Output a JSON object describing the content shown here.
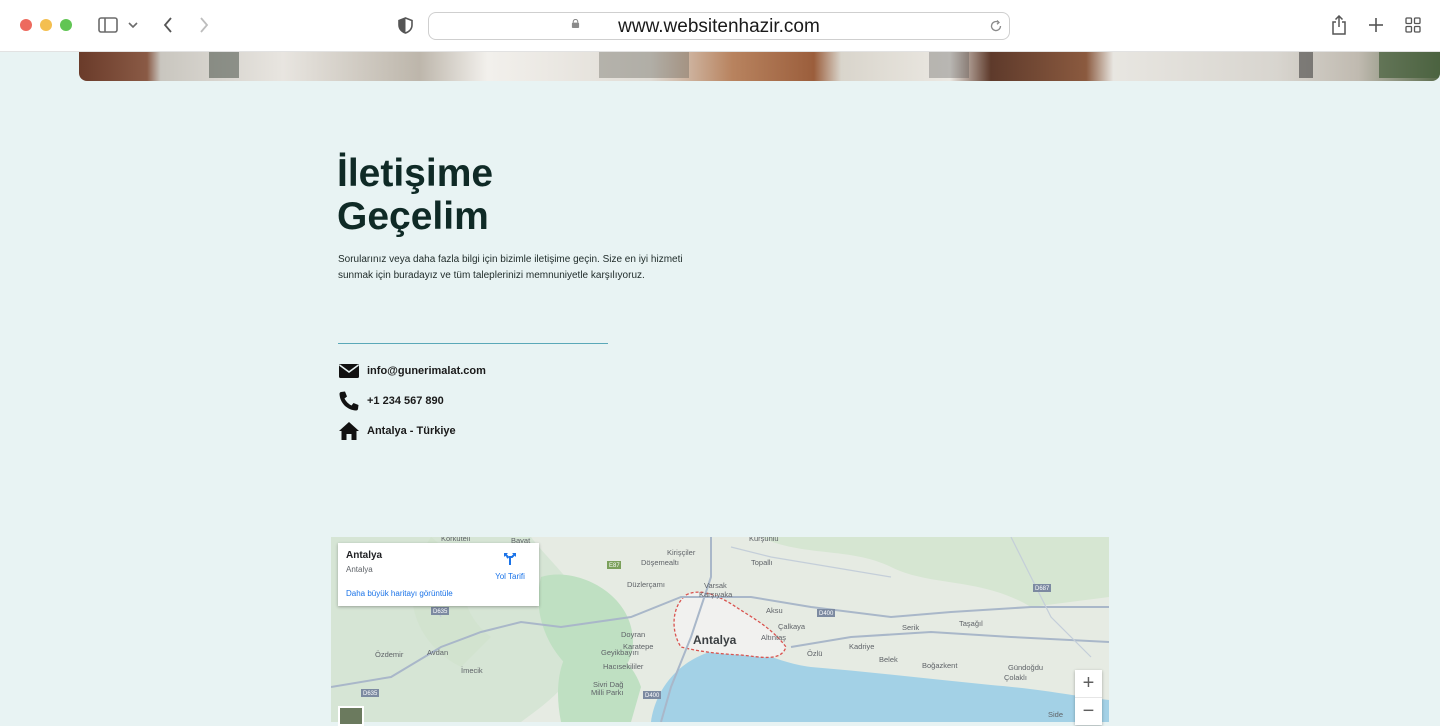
{
  "browser": {
    "url": "www.websitenhazir.com",
    "icons": [
      "sidebar-icon",
      "chevron-down-icon",
      "back-icon",
      "forward-icon",
      "shield-icon",
      "lock-icon",
      "reload-icon",
      "share-icon",
      "new-tab-icon",
      "tabs-grid-icon"
    ]
  },
  "contact": {
    "title_line1": "İletişime",
    "title_line2": "Geçelim",
    "description": "Sorularınız veya daha fazla bilgi için bizimle iletişime geçin. Size en iyi hizmeti sunmak için buradayız ve tüm taleplerinizi memnuniyetle karşılıyoruz.",
    "email": "info@gunerimalat.com",
    "phone": "+1 234 567 890",
    "address": "Antalya - Türkiye"
  },
  "map": {
    "card_name": "Antalya",
    "card_address": "Antalya",
    "directions_label": "Yol Tarifi",
    "larger_map_link": "Daha büyük haritayı görüntüle",
    "zoom_in": "+",
    "zoom_out": "−",
    "city_label": "Antalya",
    "place_labels": [
      "Korkuteli",
      "Bayat",
      "Kurşunlu",
      "Kirişçiler",
      "Döşemealtı",
      "Topallı",
      "Düzlerçamı",
      "Varsak",
      "Karşıyaka",
      "Aksu",
      "Çalkaya",
      "Serik",
      "Taşağıl",
      "Doyran",
      "Altıntaş",
      "Kadriye",
      "Boğazkent",
      "Gündoğdu",
      "Çolaklı",
      "Özdemir",
      "Avdan",
      "İmecik",
      "Geyikbayırı",
      "Karatepe",
      "Hacısekililer",
      "Sivri Dağ Milli Parkı",
      "Belek",
      "Özlü",
      "Side"
    ],
    "road_labels": [
      "E87",
      "D400",
      "D635",
      "D685",
      "D687"
    ],
    "colors": {
      "sea": "#a3d1e6",
      "park": "#bfe0c2",
      "land": "#e6ebe3",
      "road": "#a9b7c9",
      "border": "#d9534f"
    }
  },
  "colors": {
    "page_bg": "#e8f3f3",
    "heading": "#0f2a26",
    "divider": "#5aa8b8"
  }
}
